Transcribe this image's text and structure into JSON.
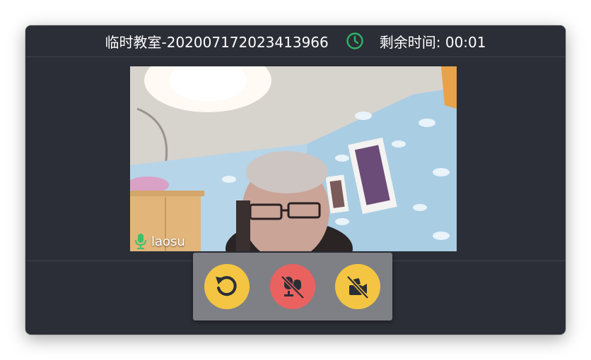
{
  "header": {
    "room_title": "临时教室-202007172023413966",
    "remaining_label": "剩余时间: 00:01"
  },
  "video": {
    "participant_name": "laosu"
  },
  "controls": [
    {
      "name": "rotate-button",
      "icon": "rotate-icon",
      "color": "#f4c542"
    },
    {
      "name": "mute-mic-button",
      "icon": "mic-off-icon",
      "color": "#e9625f"
    },
    {
      "name": "camera-off-button",
      "icon": "camera-off-icon",
      "color": "#f4c542"
    }
  ],
  "colors": {
    "clock_accent": "#2eb46a",
    "mic_accent": "#3fbf6a",
    "window_bg": "#2b2e36",
    "control_panel_bg": "#7e8085"
  }
}
